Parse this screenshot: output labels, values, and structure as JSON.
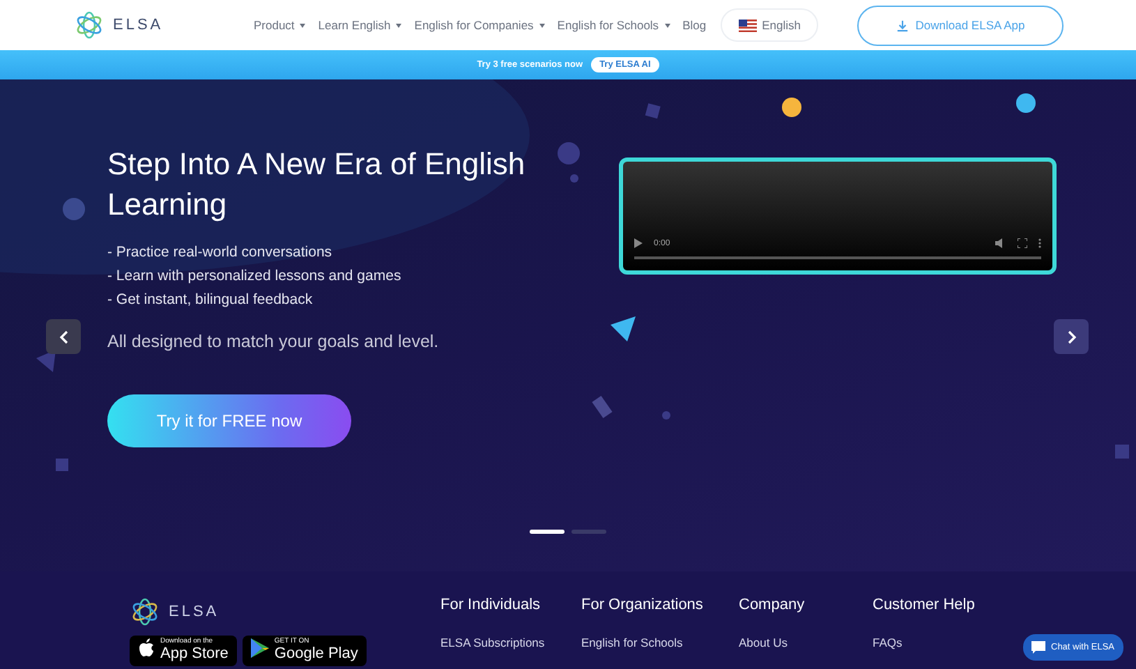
{
  "header": {
    "logo": "ELSA",
    "nav": [
      {
        "label": "Product",
        "dropdown": true
      },
      {
        "label": "Learn English",
        "dropdown": true
      },
      {
        "label": "English for Companies",
        "dropdown": true
      },
      {
        "label": "English for Schools",
        "dropdown": true
      },
      {
        "label": "Blog",
        "dropdown": false
      }
    ],
    "language": "English",
    "download": "Download ELSA App"
  },
  "promo": {
    "text": "Try 3 free scenarios now",
    "button": "Try ELSA AI"
  },
  "hero": {
    "title": "Step Into A New Era of English Learning",
    "bullets": [
      "- Practice real-world conversations",
      "- Learn with personalized lessons and games",
      "- Get instant, bilingual feedback"
    ],
    "subtitle": "All designed to match your goals and level.",
    "cta": "Try it for FREE now",
    "video": {
      "time": "0:00",
      "level": 0
    },
    "slides": [
      {
        "selected": true
      },
      {
        "selected": false
      }
    ]
  },
  "footer": {
    "logo": "ELSA",
    "stores": [
      {
        "kind": "apple",
        "small": "Download on the",
        "big": "App Store"
      },
      {
        "kind": "google",
        "small": "GET IT ON",
        "big": "Google Play"
      }
    ],
    "columns": [
      {
        "heading": "For Individuals",
        "links": [
          "ELSA Subscriptions"
        ]
      },
      {
        "heading": "For Organizations",
        "links": [
          "English for Schools"
        ]
      },
      {
        "heading": "Company",
        "links": [
          "About Us"
        ]
      },
      {
        "heading": "Customer Help",
        "links": [
          "FAQs"
        ]
      }
    ],
    "chat": "Chat with ELSA"
  }
}
